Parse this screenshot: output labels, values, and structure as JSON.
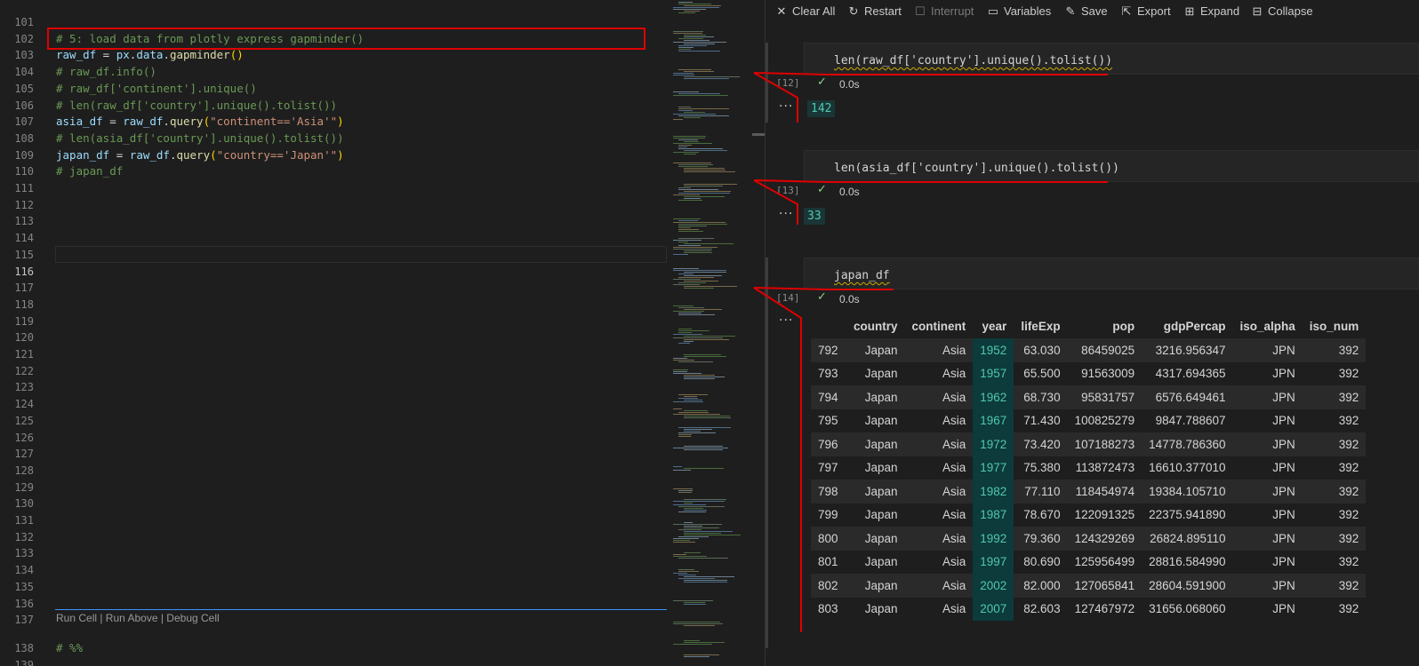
{
  "editor": {
    "lines": [
      {
        "n": "101",
        "tokens": []
      },
      {
        "n": "102",
        "tokens": [
          {
            "c": "com",
            "t": "# 5: load data from plotly express gapminder()"
          }
        ]
      },
      {
        "n": "103",
        "tokens": [
          {
            "c": "var",
            "t": "raw_df"
          },
          {
            "c": "def",
            "t": " = "
          },
          {
            "c": "var",
            "t": "px"
          },
          {
            "c": "def",
            "t": "."
          },
          {
            "c": "var",
            "t": "data"
          },
          {
            "c": "def",
            "t": "."
          },
          {
            "c": "fn",
            "t": "gapminder"
          },
          {
            "c": "p1",
            "t": "()"
          }
        ]
      },
      {
        "n": "104",
        "tokens": [
          {
            "c": "com",
            "t": "# raw_df.info()"
          }
        ]
      },
      {
        "n": "105",
        "tokens": [
          {
            "c": "com",
            "t": "# raw_df['continent'].unique()"
          }
        ]
      },
      {
        "n": "106",
        "tokens": [
          {
            "c": "com",
            "t": "# len(raw_df['country'].unique().tolist())"
          }
        ]
      },
      {
        "n": "107",
        "tokens": [
          {
            "c": "var",
            "t": "asia_df"
          },
          {
            "c": "def",
            "t": " = "
          },
          {
            "c": "var",
            "t": "raw_df"
          },
          {
            "c": "def",
            "t": "."
          },
          {
            "c": "fn",
            "t": "query"
          },
          {
            "c": "p1",
            "t": "("
          },
          {
            "c": "str",
            "t": "\"continent=='Asia'\""
          },
          {
            "c": "p1",
            "t": ")"
          }
        ]
      },
      {
        "n": "108",
        "tokens": [
          {
            "c": "com",
            "t": "# len(asia_df['country'].unique().tolist())"
          }
        ]
      },
      {
        "n": "109",
        "tokens": [
          {
            "c": "var",
            "t": "japan_df"
          },
          {
            "c": "def",
            "t": " = "
          },
          {
            "c": "var",
            "t": "raw_df"
          },
          {
            "c": "def",
            "t": "."
          },
          {
            "c": "fn",
            "t": "query"
          },
          {
            "c": "p1",
            "t": "("
          },
          {
            "c": "str",
            "t": "\"country=='Japan'\""
          },
          {
            "c": "p1",
            "t": ")"
          }
        ]
      },
      {
        "n": "110",
        "tokens": [
          {
            "c": "com",
            "t": "# japan_df"
          }
        ]
      },
      {
        "n": "111",
        "tokens": []
      },
      {
        "n": "112",
        "tokens": []
      },
      {
        "n": "113",
        "tokens": []
      },
      {
        "n": "114",
        "tokens": []
      },
      {
        "n": "115",
        "tokens": []
      },
      {
        "n": "116",
        "tokens": [],
        "active": true
      },
      {
        "n": "117",
        "tokens": []
      },
      {
        "n": "118",
        "tokens": []
      },
      {
        "n": "119",
        "tokens": []
      },
      {
        "n": "120",
        "tokens": []
      },
      {
        "n": "121",
        "tokens": []
      },
      {
        "n": "122",
        "tokens": []
      },
      {
        "n": "123",
        "tokens": []
      },
      {
        "n": "124",
        "tokens": []
      },
      {
        "n": "125",
        "tokens": []
      },
      {
        "n": "126",
        "tokens": []
      },
      {
        "n": "127",
        "tokens": []
      },
      {
        "n": "128",
        "tokens": []
      },
      {
        "n": "129",
        "tokens": []
      },
      {
        "n": "130",
        "tokens": []
      },
      {
        "n": "131",
        "tokens": []
      },
      {
        "n": "132",
        "tokens": []
      },
      {
        "n": "133",
        "tokens": []
      },
      {
        "n": "134",
        "tokens": []
      },
      {
        "n": "135",
        "tokens": []
      },
      {
        "n": "136",
        "tokens": []
      },
      {
        "n": "137",
        "tokens": []
      },
      {
        "n": "138",
        "tokens": [
          {
            "c": "com",
            "t": "# %%"
          }
        ]
      },
      {
        "n": "139",
        "tokens": []
      }
    ],
    "codelens": "Run Cell | Run Above | Debug Cell"
  },
  "toolbar": {
    "clear_all": "Clear All",
    "restart": "Restart",
    "interrupt": "Interrupt",
    "variables": "Variables",
    "save": "Save",
    "export": "Export",
    "expand": "Expand",
    "collapse": "Collapse"
  },
  "cells": [
    {
      "exec": "[12]",
      "code": "len(raw_df['country'].unique().tolist())",
      "duration": "0.0s",
      "output": "142"
    },
    {
      "exec": "[13]",
      "code": "len(asia_df['country'].unique().tolist())",
      "duration": "0.0s",
      "output": "33"
    },
    {
      "exec": "[14]",
      "code": "japan_df",
      "duration": "0.0s"
    }
  ],
  "table": {
    "headers": [
      "",
      "country",
      "continent",
      "year",
      "lifeExp",
      "pop",
      "gdpPercap",
      "iso_alpha",
      "iso_num"
    ],
    "rows": [
      [
        "792",
        "Japan",
        "Asia",
        "1952",
        "63.030",
        "86459025",
        "3216.956347",
        "JPN",
        "392"
      ],
      [
        "793",
        "Japan",
        "Asia",
        "1957",
        "65.500",
        "91563009",
        "4317.694365",
        "JPN",
        "392"
      ],
      [
        "794",
        "Japan",
        "Asia",
        "1962",
        "68.730",
        "95831757",
        "6576.649461",
        "JPN",
        "392"
      ],
      [
        "795",
        "Japan",
        "Asia",
        "1967",
        "71.430",
        "100825279",
        "9847.788607",
        "JPN",
        "392"
      ],
      [
        "796",
        "Japan",
        "Asia",
        "1972",
        "73.420",
        "107188273",
        "14778.786360",
        "JPN",
        "392"
      ],
      [
        "797",
        "Japan",
        "Asia",
        "1977",
        "75.380",
        "113872473",
        "16610.377010",
        "JPN",
        "392"
      ],
      [
        "798",
        "Japan",
        "Asia",
        "1982",
        "77.110",
        "118454974",
        "19384.105710",
        "JPN",
        "392"
      ],
      [
        "799",
        "Japan",
        "Asia",
        "1987",
        "78.670",
        "122091325",
        "22375.941890",
        "JPN",
        "392"
      ],
      [
        "800",
        "Japan",
        "Asia",
        "1992",
        "79.360",
        "124329269",
        "26824.895110",
        "JPN",
        "392"
      ],
      [
        "801",
        "Japan",
        "Asia",
        "1997",
        "80.690",
        "125956499",
        "28816.584990",
        "JPN",
        "392"
      ],
      [
        "802",
        "Japan",
        "Asia",
        "2002",
        "82.000",
        "127065841",
        "28604.591900",
        "JPN",
        "392"
      ],
      [
        "803",
        "Japan",
        "Asia",
        "2007",
        "82.603",
        "127467972",
        "31656.068060",
        "JPN",
        "392"
      ]
    ]
  },
  "colors": {
    "annotation": "#e00000",
    "output_accent": "#4ec9b0",
    "success": "#89d185"
  }
}
